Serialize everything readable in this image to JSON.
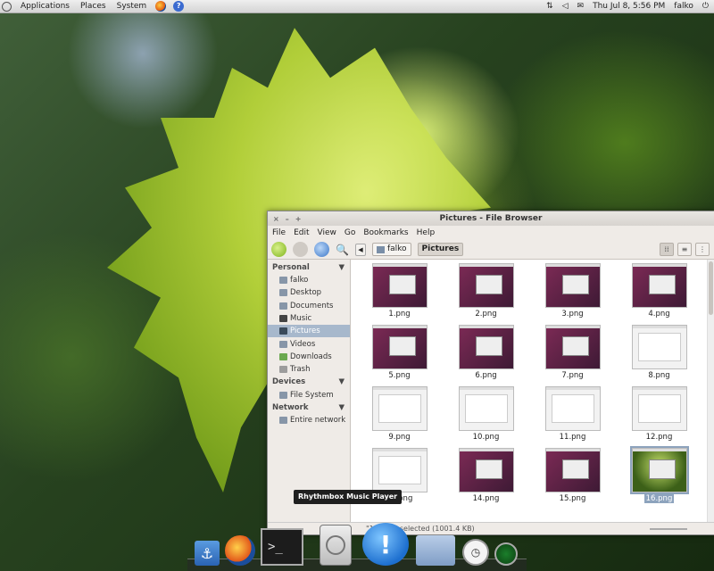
{
  "panel": {
    "menus": [
      "Applications",
      "Places",
      "System"
    ],
    "datetime": "Thu Jul  8,  5:56 PM",
    "user": "falko",
    "tray_icons": [
      "network-icon",
      "volume-icon",
      "mail-icon",
      "power-icon"
    ]
  },
  "window": {
    "title": "Pictures - File Browser",
    "menu": [
      "File",
      "Edit",
      "View",
      "Go",
      "Bookmarks",
      "Help"
    ],
    "path": [
      "falko",
      "Pictures"
    ],
    "sidebar": {
      "personal_label": "Personal",
      "personal": [
        "falko",
        "Desktop",
        "Documents",
        "Music",
        "Pictures",
        "Videos",
        "Downloads",
        "Trash"
      ],
      "devices_label": "Devices",
      "devices": [
        "File System"
      ],
      "network_label": "Network",
      "network": [
        "Entire network"
      ]
    },
    "files": [
      {
        "name": "1.png",
        "style": "purple"
      },
      {
        "name": "2.png",
        "style": "purple"
      },
      {
        "name": "3.png",
        "style": "purple"
      },
      {
        "name": "4.png",
        "style": "purple"
      },
      {
        "name": "5.png",
        "style": "purple"
      },
      {
        "name": "6.png",
        "style": "purple"
      },
      {
        "name": "7.png",
        "style": "purple"
      },
      {
        "name": "8.png",
        "style": "white"
      },
      {
        "name": "9.png",
        "style": "white"
      },
      {
        "name": "10.png",
        "style": "white"
      },
      {
        "name": "11.png",
        "style": "white"
      },
      {
        "name": "12.png",
        "style": "white"
      },
      {
        "name": "13.png",
        "style": "white"
      },
      {
        "name": "14.png",
        "style": "purple"
      },
      {
        "name": "15.png",
        "style": "purple"
      },
      {
        "name": "16.png",
        "style": "green",
        "selected": true
      }
    ],
    "status": "\"16.png\" selected (1001.4 KB)"
  },
  "tooltip": "Rhythmbox Music Player",
  "dock": {
    "terminal_prompt": ">_",
    "notify_glyph": "!"
  }
}
